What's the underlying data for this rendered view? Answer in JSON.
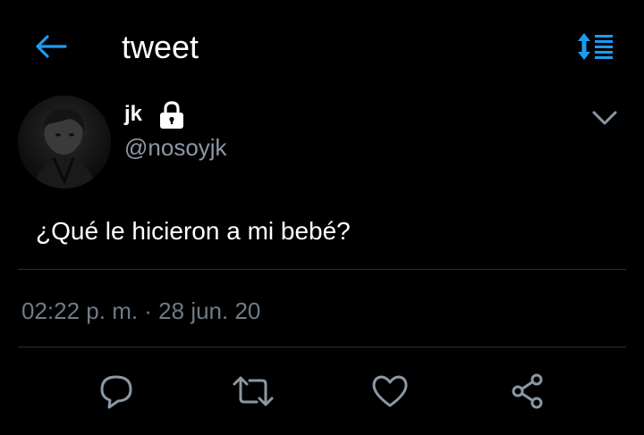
{
  "header": {
    "title": "tweet",
    "back_icon": "arrow-left-icon",
    "sort_icon": "sort-icon"
  },
  "tweet": {
    "display_name": "jk",
    "handle": "@nosoyjk",
    "protected_icon": "lock-icon",
    "more_icon": "chevron-down-icon",
    "text": "¿Qué le hicieron a mi bebé?",
    "timestamp": "02:22 p. m. · 28 jun. 20"
  },
  "actions": [
    {
      "name": "reply",
      "icon": "comment-icon"
    },
    {
      "name": "retweet",
      "icon": "retweet-icon"
    },
    {
      "name": "like",
      "icon": "heart-icon"
    },
    {
      "name": "share",
      "icon": "share-icon"
    }
  ],
  "colors": {
    "background": "#000000",
    "accent": "#1d9bf0",
    "secondary_text": "#8b98a5",
    "muted_text": "#6e7b86",
    "divider": "#2b2f33",
    "icon_gray": "#8b98a5"
  }
}
